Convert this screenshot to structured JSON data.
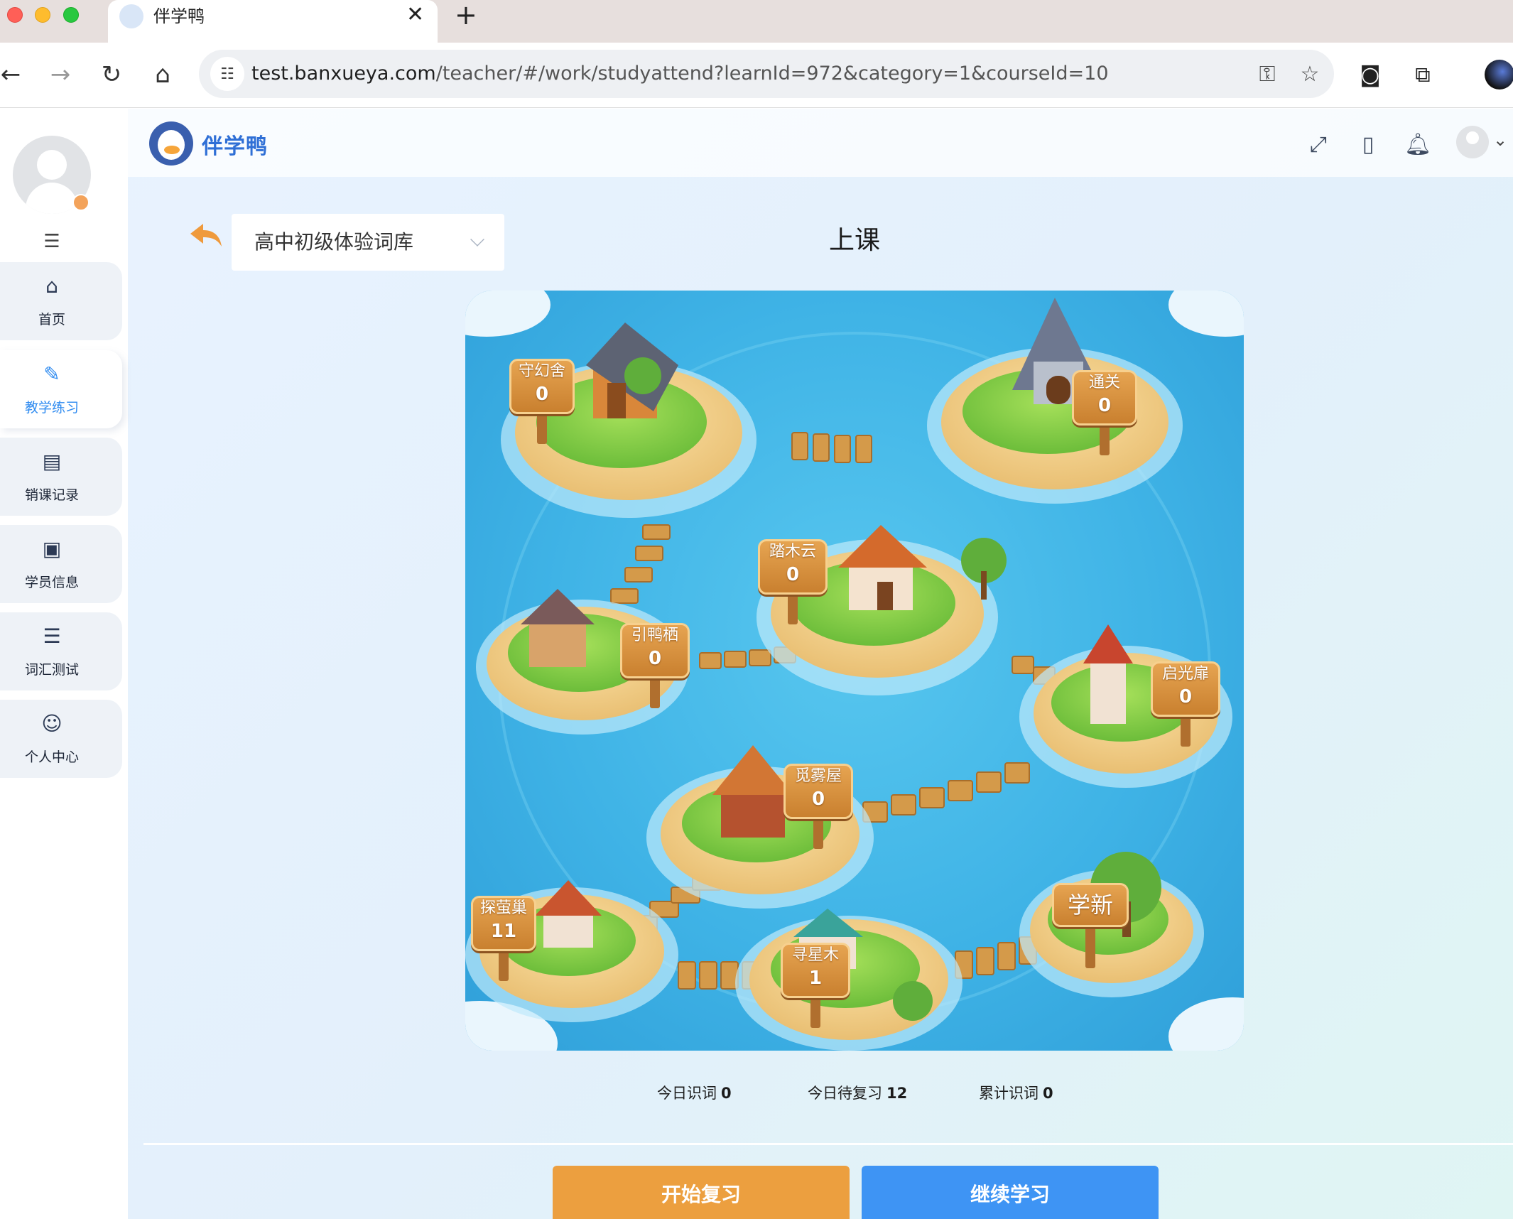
{
  "browser": {
    "tab_title": "伴学鸭",
    "tab_close": "✕",
    "new_tab": "+",
    "url_host": "test.banxueya.com",
    "url_path": "/teacher/#/work/studyattend?learnId=972&category=1&courseId=10",
    "icons": [
      "back-icon",
      "forward-icon",
      "reload-icon",
      "home-icon",
      "site-settings-icon",
      "password-key-icon",
      "bookmark-star-icon",
      "extension-icon",
      "puzzle-icon",
      "profile-icon"
    ]
  },
  "app": {
    "logo_text": "伴学鸭",
    "sidebar": {
      "items": [
        {
          "label": "首页",
          "icon": "home-icon",
          "active": false
        },
        {
          "label": "教学练习",
          "icon": "pen-icon",
          "active": true
        },
        {
          "label": "销课记录",
          "icon": "record-icon",
          "active": false
        },
        {
          "label": "学员信息",
          "icon": "id-card-icon",
          "active": false
        },
        {
          "label": "词汇测试",
          "icon": "test-icon",
          "active": false
        },
        {
          "label": "个人中心",
          "icon": "user-icon",
          "active": false
        }
      ]
    },
    "topbar_icons": [
      "fullscreen-icon",
      "phone-icon",
      "bell-icon",
      "avatar"
    ],
    "course_select": "高中初级体验词库",
    "page_title": "上课",
    "map_nodes": [
      {
        "name": "守幻舍",
        "count": "0"
      },
      {
        "name": "通关",
        "count": "0"
      },
      {
        "name": "踏木云",
        "count": "0"
      },
      {
        "name": "引鸭栖",
        "count": "0"
      },
      {
        "name": "启光扉",
        "count": "0"
      },
      {
        "name": "觅雾屋",
        "count": "0"
      },
      {
        "name": "探萤巢",
        "count": "11"
      },
      {
        "name": "学新",
        "count": ""
      },
      {
        "name": "寻星木",
        "count": "1"
      }
    ],
    "stats": [
      {
        "label": "今日识词",
        "value": "0"
      },
      {
        "label": "今日待复习",
        "value": "12"
      },
      {
        "label": "累计识词",
        "value": "0"
      }
    ],
    "buttons": {
      "review": "开始复习",
      "continue": "继续学习"
    },
    "colors": {
      "accent_blue": "#3e94f4",
      "accent_orange": "#ec9f3f"
    }
  }
}
